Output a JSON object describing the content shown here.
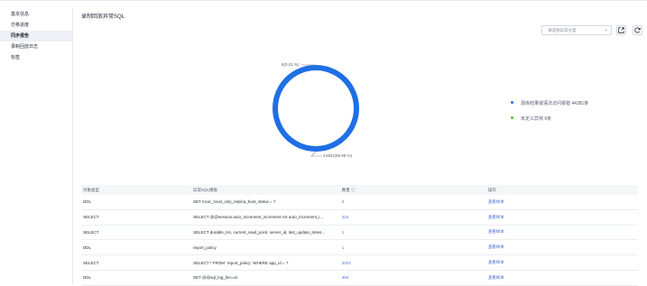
{
  "sidebar": {
    "items": [
      {
        "label": "基本信息",
        "active": false
      },
      {
        "label": "迁移进度",
        "active": false
      },
      {
        "label": "同步报告",
        "active": true
      },
      {
        "label": "录制回放日志",
        "active": false
      },
      {
        "label": "标签",
        "active": false
      }
    ]
  },
  "section": {
    "title": "录制回放异常SQL"
  },
  "toolbar": {
    "select_placeholder": "请选择异常分类",
    "chevron_icon": "chevron-down-icon",
    "export_icon": "export-icon",
    "refresh_icon": "refresh-icon"
  },
  "chart_data": {
    "type": "pie",
    "style": "donut",
    "slices": [
      {
        "name": "源库结果或语法访问报错",
        "value": 44381,
        "label": "44381(99.99 %)",
        "color": "#1f6fe5"
      },
      {
        "name": "未定义异常",
        "value": 6,
        "label": "6(0.01 %)",
        "color": "#52c41a"
      }
    ],
    "legend_position": "right"
  },
  "legend": {
    "items": [
      {
        "label": "源库结果或语法访问报错  44381条",
        "color": "#1f6fe5"
      },
      {
        "label": "未定义异常  6条",
        "color": "#52c41a"
      }
    ]
  },
  "table": {
    "headers": [
      "对象类型",
      "异常SQL模板",
      "数量 ⓘ",
      "操作"
    ],
    "rows": [
      {
        "type": "DDL",
        "sql": "SET mcar_local_only_replica_host_status = ?",
        "count": "3",
        "action": "查看样本"
      },
      {
        "type": "SELECT",
        "sql": "SELECT @@session.auto_increment_increment AS auto_increment_i...",
        "count": "424",
        "action": "查看样本"
      },
      {
        "type": "SELECT",
        "sql": "SELECT durable_lsn, current_read_point, server_id, last_update_times...",
        "count": "1",
        "action": "查看样本"
      },
      {
        "type": "DDL",
        "sql": "report_policy",
        "count": "1",
        "action": "查看样本"
      },
      {
        "type": "SELECT",
        "sql": "SELECT * FROM `report_policy` WHERE app_id = ?",
        "count": "2024",
        "action": "查看样本"
      },
      {
        "type": "DDL",
        "sql": "SET @@sql_log_bin=on",
        "count": "494",
        "action": "查看样本"
      }
    ]
  }
}
